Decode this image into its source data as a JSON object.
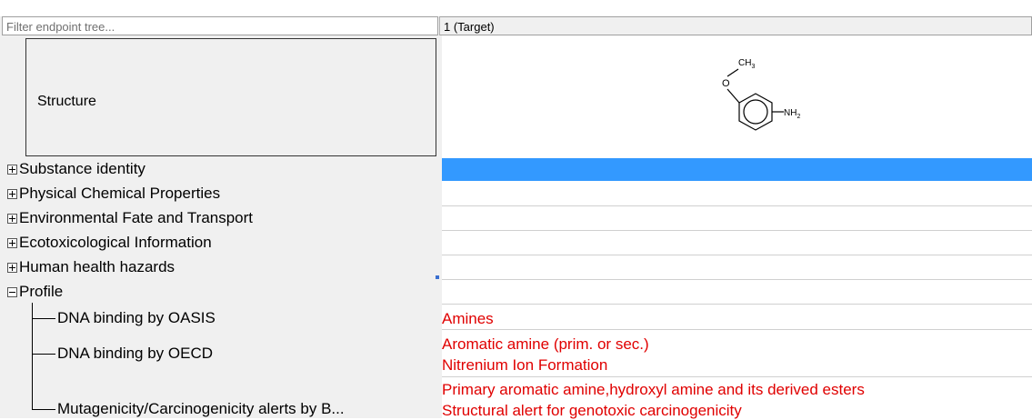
{
  "filter": {
    "placeholder": "Filter endpoint tree..."
  },
  "column_header": "1 (Target)",
  "structure": {
    "label": "Structure",
    "molecule": {
      "ch3": "CH3",
      "o": "O",
      "nh2": "NH2"
    }
  },
  "tree": {
    "categories": [
      {
        "label": "Substance identity",
        "expanded": false
      },
      {
        "label": "Physical Chemical Properties",
        "expanded": false
      },
      {
        "label": "Environmental Fate and Transport",
        "expanded": false
      },
      {
        "label": "Ecotoxicological Information",
        "expanded": false
      },
      {
        "label": "Human health hazards",
        "expanded": false
      },
      {
        "label": "Profile",
        "expanded": true
      }
    ],
    "profile_children": [
      {
        "label": "DNA binding by OASIS",
        "values": [
          "Amines"
        ]
      },
      {
        "label": "DNA binding by OECD",
        "values": [
          "Aromatic amine (prim. or sec.)",
          "Nitrenium Ion Formation"
        ]
      },
      {
        "label": "Mutagenicity/Carcinogenicity alerts by B...",
        "values": [
          "Primary aromatic amine,hydroxyl amine and its derived esters",
          "Structural alert for genotoxic carcinogenicity"
        ]
      }
    ]
  },
  "colors": {
    "selection": "#3399ff",
    "value_text": "#e00000"
  }
}
